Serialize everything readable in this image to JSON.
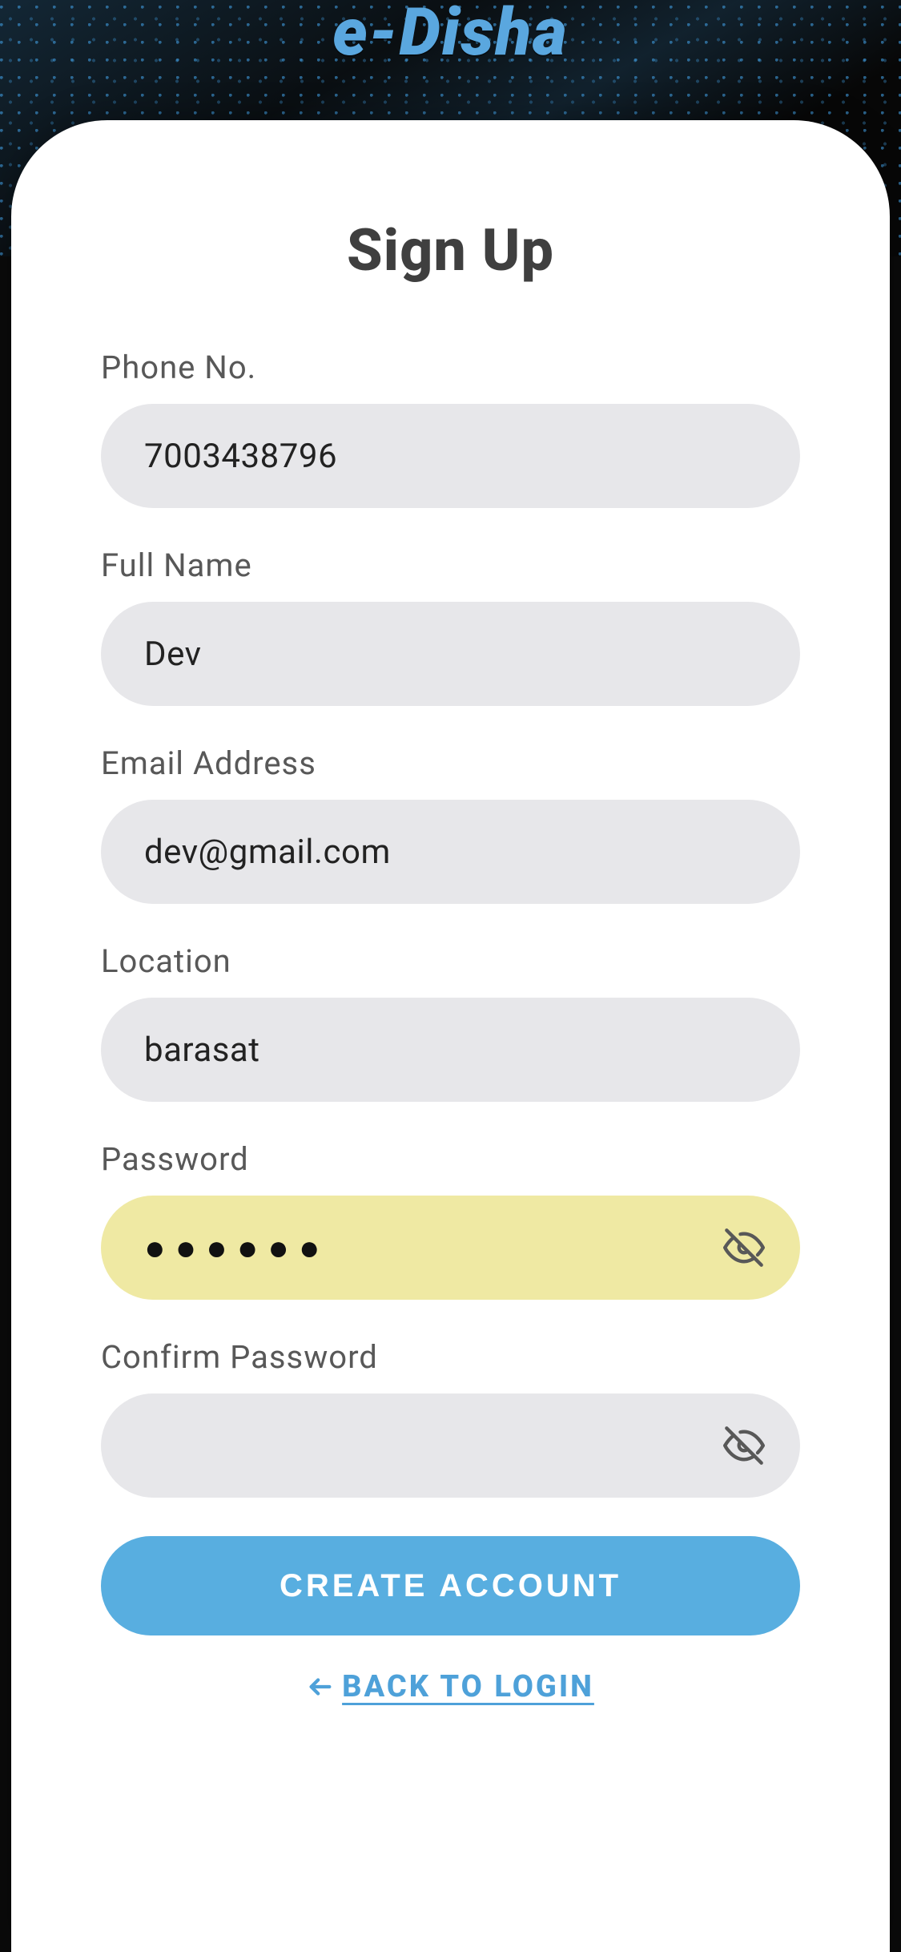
{
  "brand": {
    "name": "e-Disha"
  },
  "form": {
    "title": "Sign Up",
    "fields": {
      "phone": {
        "label": "Phone No.",
        "value": "7003438796"
      },
      "fullname": {
        "label": "Full Name",
        "value": "Dev"
      },
      "email": {
        "label": "Email Address",
        "value": "dev@gmail.com"
      },
      "location": {
        "label": "Location",
        "value": "barasat"
      },
      "password": {
        "label": "Password",
        "masked_value": "●●●●●●"
      },
      "confirm": {
        "label": "Confirm Password",
        "masked_value": ""
      }
    },
    "submit_label": "CREATE ACCOUNT",
    "back_label": "BACK TO LOGIN"
  },
  "colors": {
    "accent": "#58aee0",
    "brand": "#5aa7df",
    "highlight": "#efe9a3"
  }
}
